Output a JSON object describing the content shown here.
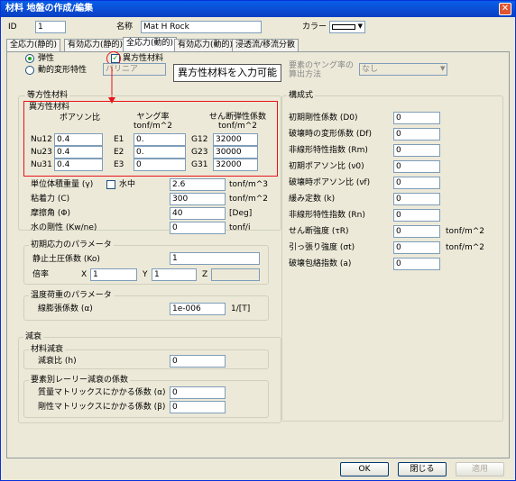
{
  "window": {
    "title": "材料 地盤の作成/編集",
    "close": "✕"
  },
  "header": {
    "id_label": "ID",
    "id_value": "1",
    "name_label": "名称",
    "name_value": "Mat H Rock",
    "color_label": "カラー"
  },
  "tabs": [
    "全応力(静的)",
    "有効応力(静的)",
    "全応力(動的)",
    "有効応力(動的)",
    "浸透流/移流分散"
  ],
  "radio": {
    "elastic": "弾性",
    "dynamic": "動的変形特性"
  },
  "aniso_check": "異方性材料",
  "dynamic_combo": "バリニア",
  "dyn_young_label": "要素のヤング率の\n算出方法",
  "dyn_young_combo": "なし",
  "callout": "異方性材料を入力可能",
  "ortho": {
    "group_title": "等方性材料",
    "sub_title": "異方性材料",
    "poisson_header": "ポアソン比",
    "young_header": "ヤング率\ntonf/m^2",
    "shear_header": "せん断弾性係数\ntonf/m^2",
    "rows": [
      {
        "n": "Nu12",
        "nv": "0.4",
        "e": "E1",
        "ev": "0.",
        "g": "G12",
        "gv": "32000"
      },
      {
        "n": "Nu23",
        "nv": "0.4",
        "e": "E2",
        "ev": "0.",
        "g": "G23",
        "gv": "30000"
      },
      {
        "n": "Nu31",
        "nv": "0.4",
        "e": "E3",
        "ev": "0",
        "g": "G31",
        "gv": "32000"
      }
    ]
  },
  "props": [
    {
      "label": "単位体積重量 (γ)",
      "value": "2.6",
      "unit": "tonf/m^3"
    },
    {
      "label": "粘着力 (C)",
      "value": "300",
      "unit": "tonf/m^2"
    },
    {
      "label": "摩擦角 (Φ)",
      "value": "40",
      "unit": "[Deg]"
    },
    {
      "label": "水の剛性 (Kw/ne)",
      "value": "0",
      "unit": "tonf/i"
    }
  ],
  "underwater": "水中",
  "initial": {
    "title": "初期応力のパラメータ",
    "k0_label": "静止土圧係数 (Ko)",
    "k0_value": "1",
    "mult_label": "倍率",
    "x_label": "X",
    "x_value": "1",
    "y_label": "Y",
    "y_value": "1",
    "z_label": "Z",
    "z_value": ""
  },
  "thermal": {
    "title": "温度荷重のパラメータ",
    "label": "線膨張係数 (α)",
    "value": "1e-006",
    "unit": "1/[T]"
  },
  "damping": {
    "title": "減衰",
    "mat_title": "材料減衰",
    "ratio_label": "減衰比 (h)",
    "ratio_value": "0",
    "rayleigh_title": "要素別レーリー減衰の係数",
    "mass_label": "質量マトリックスにかかる係数 (α)",
    "mass_value": "0",
    "stiff_label": "剛性マトリックスにかかる係数 (β)",
    "stiff_value": "0"
  },
  "constitutive": {
    "title": "構成式",
    "rows": [
      {
        "label": "初期剛性係数 (D0)",
        "value": "0",
        "unit": ""
      },
      {
        "label": "破壊時の変形係数 (Df)",
        "value": "0",
        "unit": ""
      },
      {
        "label": "非線形特性指数 (Rm)",
        "value": "0",
        "unit": ""
      },
      {
        "label": "初期ポアソン比 (ν0)",
        "value": "0",
        "unit": ""
      },
      {
        "label": "破壊時ポアソン比 (νf)",
        "value": "0",
        "unit": ""
      },
      {
        "label": "緩み定数 (k)",
        "value": "0",
        "unit": ""
      },
      {
        "label": "非線形特性指数 (Rn)",
        "value": "0",
        "unit": ""
      },
      {
        "label": "せん断強度 (τR)",
        "value": "0",
        "unit": "tonf/m^2"
      },
      {
        "label": "引っ張り強度 (σt)",
        "value": "0",
        "unit": "tonf/m^2"
      },
      {
        "label": "破壊包絡指数 (a)",
        "value": "0",
        "unit": ""
      }
    ]
  },
  "buttons": {
    "ok": "OK",
    "close": "閉じる",
    "apply": "適用"
  }
}
